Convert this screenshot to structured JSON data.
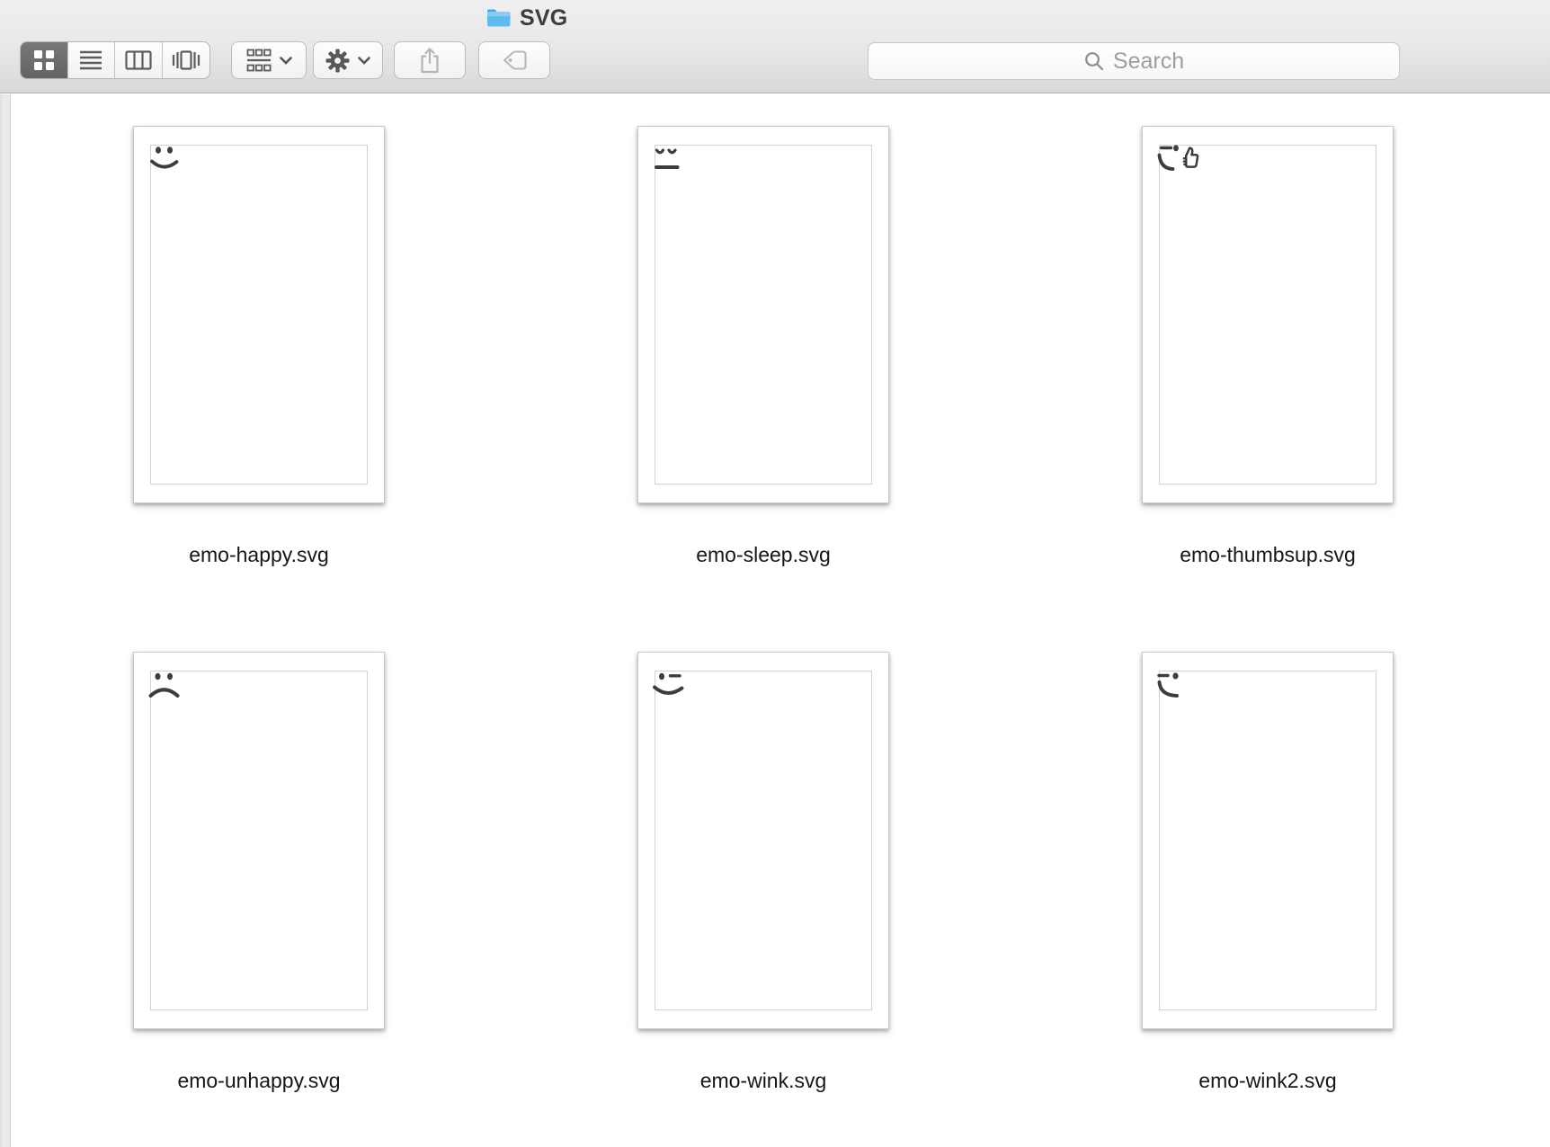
{
  "window": {
    "title": "SVG",
    "proxy_icon": "folder-icon",
    "folder_color": "#52b0e7"
  },
  "toolbar": {
    "view_controls": [
      {
        "id": "icon-view",
        "icon": "grid-view-icon",
        "selected": true
      },
      {
        "id": "list-view",
        "icon": "list-view-icon",
        "selected": false
      },
      {
        "id": "column-view",
        "icon": "column-view-icon",
        "selected": false
      },
      {
        "id": "coverflow-view",
        "icon": "coverflow-view-icon",
        "selected": false
      }
    ],
    "arrange_button": {
      "icon": "arrange-grid-icon",
      "chevron": "chevron-down-icon"
    },
    "action_button": {
      "icon": "gear-icon",
      "chevron": "chevron-down-icon"
    },
    "share_button": {
      "icon": "share-icon",
      "disabled": true
    },
    "tags_button": {
      "icon": "tag-icon",
      "disabled": true
    },
    "search": {
      "placeholder": "Search",
      "icon": "search-icon"
    }
  },
  "files": [
    {
      "name": "emo-happy.svg",
      "face": "happy"
    },
    {
      "name": "emo-sleep.svg",
      "face": "sleep"
    },
    {
      "name": "emo-thumbsup.svg",
      "face": "thumbsup"
    },
    {
      "name": "emo-unhappy.svg",
      "face": "unhappy"
    },
    {
      "name": "emo-wink.svg",
      "face": "wink"
    },
    {
      "name": "emo-wink2.svg",
      "face": "wink2"
    }
  ],
  "colors": {
    "toolbar_gradient_top": "#efefef",
    "toolbar_gradient_bottom": "#d9d9d9",
    "toolbar_border": "#b2b2b2",
    "selected_segment": "#6d6d6d",
    "glyph_gray": "#5a5a5a",
    "glyph_disabled": "#b5b5b5",
    "face_stroke": "#3d3d3d",
    "search_placeholder_color": "#9e9e9e",
    "label_color": "#161616"
  }
}
